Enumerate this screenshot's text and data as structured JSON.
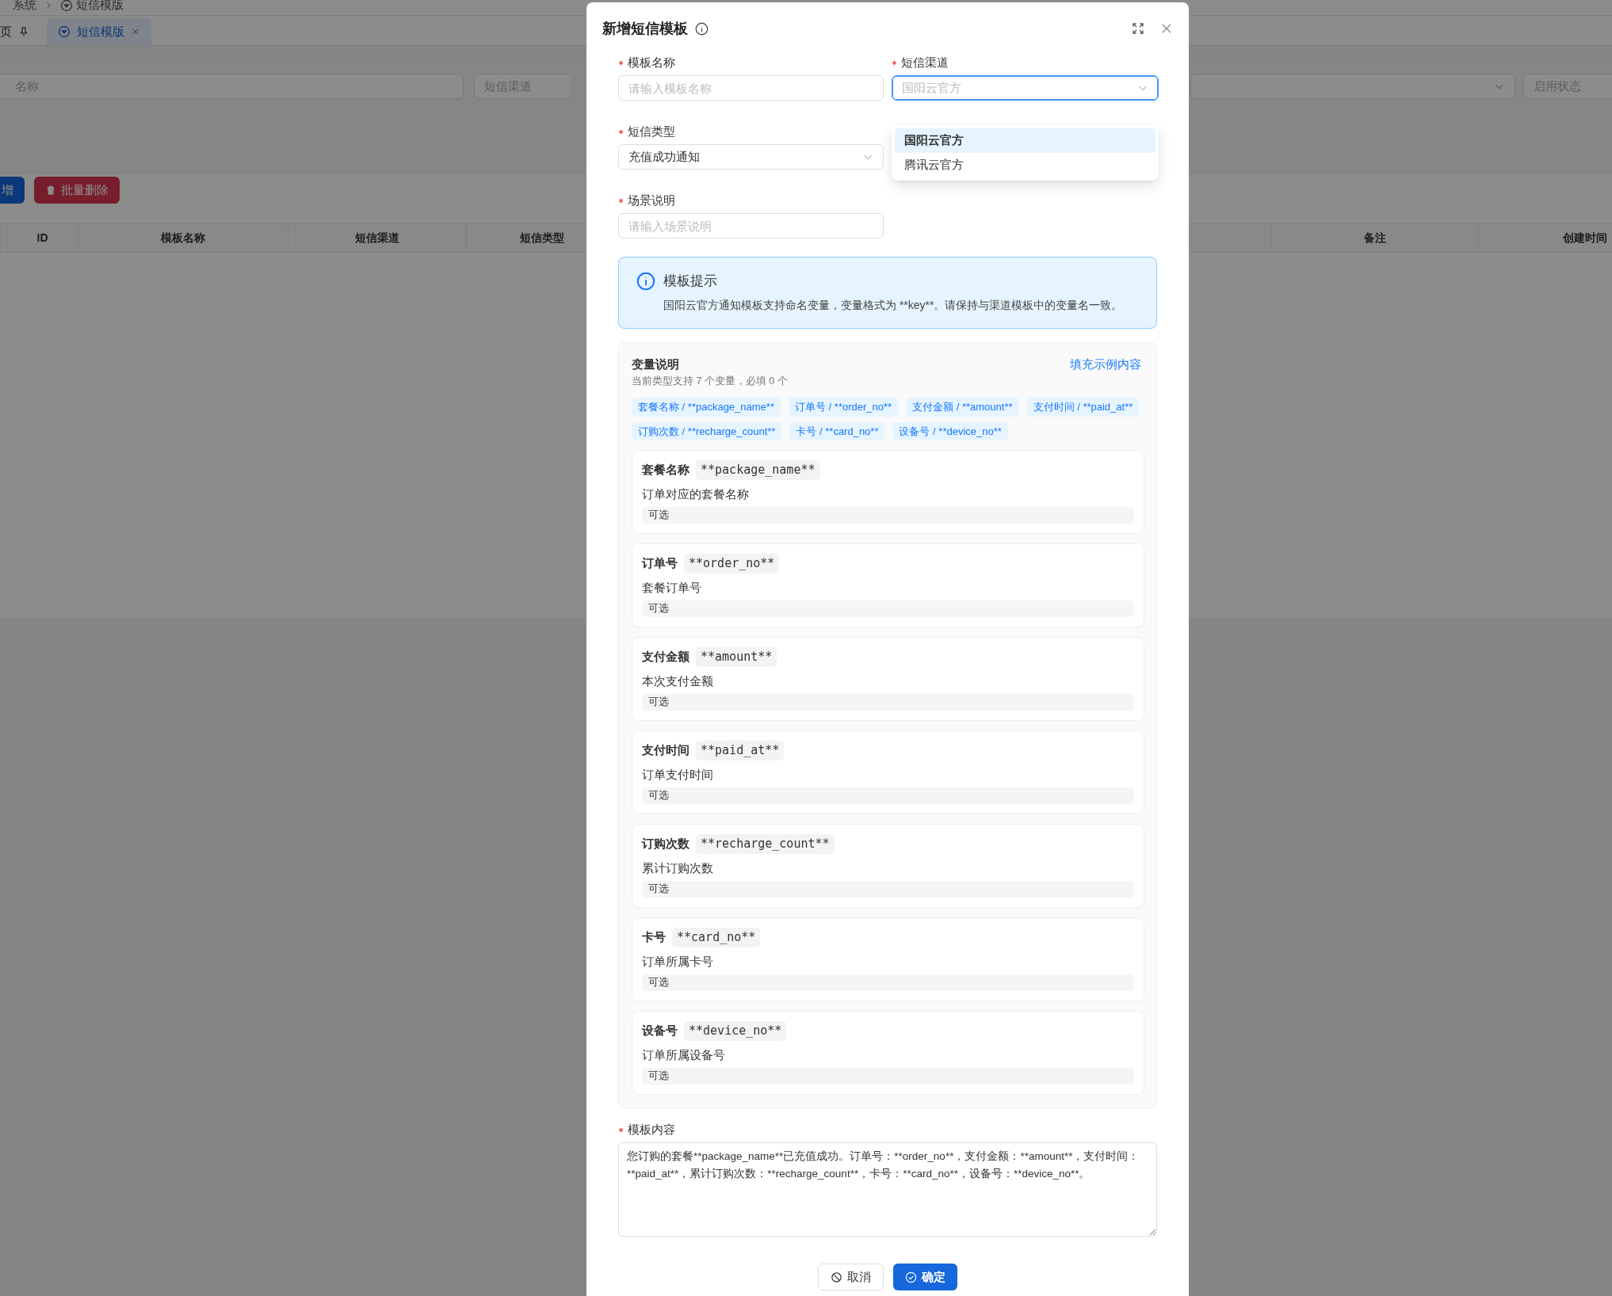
{
  "breadcrumb": [
    {
      "label": "系统",
      "icon": false
    },
    {
      "label": "短信模版",
      "icon": true
    }
  ],
  "page_tabs": [
    {
      "label": "页",
      "selected": false,
      "pinned": true,
      "closable": false
    },
    {
      "label": "短信模版",
      "selected": true,
      "pinned": false,
      "closable": true
    }
  ],
  "filters": [
    {
      "kind": "input",
      "placeholder": "名称"
    },
    {
      "kind": "input",
      "placeholder": "短信渠道"
    },
    {
      "kind": "select"
    },
    {
      "kind": "input",
      "placeholder": "启用状态"
    }
  ],
  "toolbar_buttons": [
    {
      "label": "增",
      "kind": "primary"
    },
    {
      "label": "批量删除",
      "kind": "danger"
    }
  ],
  "table": {
    "columns": [
      {
        "label": "ID"
      },
      {
        "label": "模板名称"
      },
      {
        "label": "短信渠道"
      },
      {
        "label": "短信类型"
      },
      {
        "label": "备注"
      },
      {
        "label": "创建时间"
      }
    ]
  },
  "dialog": {
    "title": "新增短信模板",
    "fields": [
      {
        "label": "模板名称",
        "required": true,
        "kind": "input",
        "placeholder": "请输入模板名称"
      },
      {
        "label": "短信渠道",
        "required": true,
        "kind": "select",
        "value": "国阳云官方",
        "open": true,
        "options": [
          {
            "label": "国阳云官方",
            "selected": true
          },
          {
            "label": "腾讯云官方",
            "selected": false
          }
        ]
      },
      {
        "label": "短信类型",
        "required": true,
        "kind": "select",
        "value": "充值成功通知",
        "open": false
      },
      {
        "label": "场景说明",
        "required": true,
        "kind": "input",
        "placeholder": "请输入场景说明"
      }
    ],
    "alert": {
      "title": "模板提示",
      "text": "国阳云官方通知模板支持命名变量，变量格式为 **key**。请保持与渠道模板中的变量名一致。"
    },
    "variables": {
      "title": "变量说明",
      "subtitle": "当前类型支持 7 个变量，必填 0 个",
      "action": "填充示例内容",
      "tags": [
        "套餐名称 / **package_name**",
        "订单号 / **order_no**",
        "支付金额 / **amount**",
        "支付时间 / **paid_at**",
        "订购次数 / **recharge_count**",
        "卡号 / **card_no**",
        "设备号 / **device_no**"
      ],
      "items": [
        {
          "name": "套餐名称",
          "key": "**package_name**",
          "description": "订单对应的套餐名称",
          "requirement": "可选"
        },
        {
          "name": "订单号",
          "key": "**order_no**",
          "description": "套餐订单号",
          "requirement": "可选"
        },
        {
          "name": "支付金额",
          "key": "**amount**",
          "description": "本次支付金额",
          "requirement": "可选"
        },
        {
          "name": "支付时间",
          "key": "**paid_at**",
          "description": "订单支付时间",
          "requirement": "可选"
        },
        {
          "name": "订购次数",
          "key": "**recharge_count**",
          "description": "累计订购次数",
          "requirement": "可选"
        },
        {
          "name": "卡号",
          "key": "**card_no**",
          "description": "订单所属卡号",
          "requirement": "可选"
        },
        {
          "name": "设备号",
          "key": "**device_no**",
          "description": "订单所属设备号",
          "requirement": "可选"
        }
      ]
    },
    "content": {
      "label": "模板内容",
      "required": true,
      "value": "您订购的套餐**package_name**已充值成功。订单号：**order_no**，支付金额：**amount**，支付时间：**paid_at**，累计订购次数：**recharge_count**，卡号：**card_no**，设备号：**device_no**。"
    },
    "buttons": [
      {
        "label": "取消",
        "kind": "default"
      },
      {
        "label": "确定",
        "kind": "primary"
      }
    ]
  }
}
